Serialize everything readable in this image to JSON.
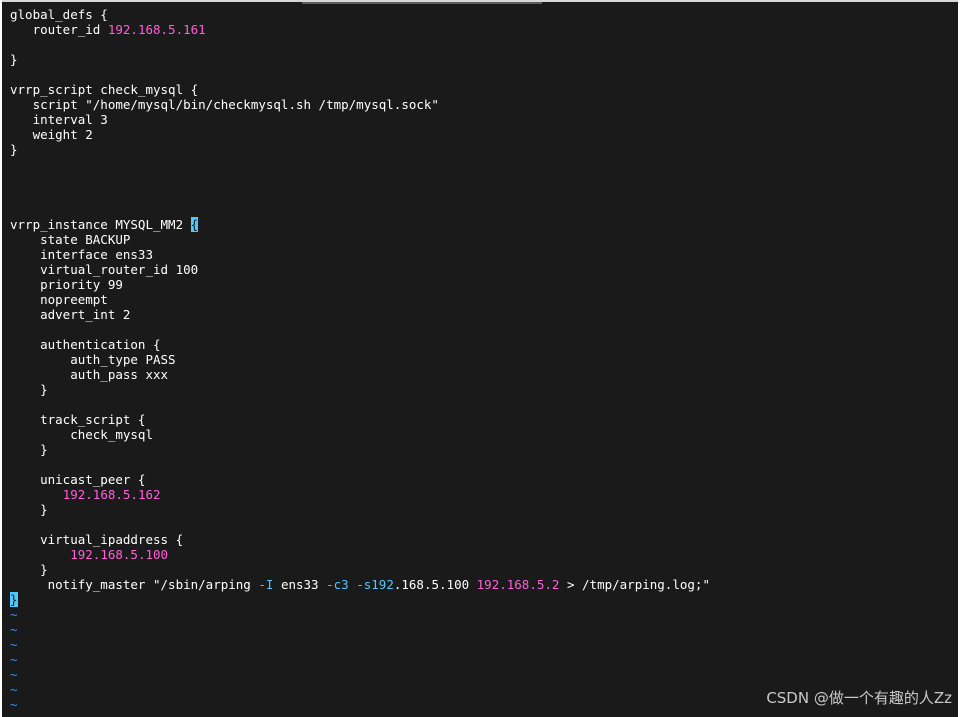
{
  "editor": {
    "lines": [
      [
        {
          "t": "global_defs {"
        }
      ],
      [
        {
          "t": "   router_id "
        },
        {
          "t": "192.168.5.161",
          "c": "magenta"
        }
      ],
      [
        {
          "t": ""
        }
      ],
      [
        {
          "t": "}"
        }
      ],
      [
        {
          "t": ""
        }
      ],
      [
        {
          "t": "vrrp_script check_mysql {"
        }
      ],
      [
        {
          "t": "   script \"/home/mysql/bin/checkmysql.sh /tmp/mysql.sock\""
        }
      ],
      [
        {
          "t": "   interval 3"
        }
      ],
      [
        {
          "t": "   weight 2"
        }
      ],
      [
        {
          "t": "}"
        }
      ],
      [
        {
          "t": ""
        }
      ],
      [
        {
          "t": ""
        }
      ],
      [
        {
          "t": ""
        }
      ],
      [
        {
          "t": ""
        }
      ],
      [
        {
          "t": "vrrp_instance MYSQL_MM2 "
        },
        {
          "t": "{",
          "c": "cursor"
        }
      ],
      [
        {
          "t": "    state BACKUP"
        }
      ],
      [
        {
          "t": "    interface ens33"
        }
      ],
      [
        {
          "t": "    virtual_router_id 100"
        }
      ],
      [
        {
          "t": "    priority 99"
        }
      ],
      [
        {
          "t": "    nopreempt"
        }
      ],
      [
        {
          "t": "    advert_int 2"
        }
      ],
      [
        {
          "t": ""
        }
      ],
      [
        {
          "t": "    authentication {"
        }
      ],
      [
        {
          "t": "        auth_type PASS"
        }
      ],
      [
        {
          "t": "        auth_pass xxx"
        }
      ],
      [
        {
          "t": "    }"
        }
      ],
      [
        {
          "t": ""
        }
      ],
      [
        {
          "t": "    track_script {"
        }
      ],
      [
        {
          "t": "        check_mysql"
        }
      ],
      [
        {
          "t": "    }"
        }
      ],
      [
        {
          "t": ""
        }
      ],
      [
        {
          "t": "    unicast_peer {"
        }
      ],
      [
        {
          "t": "       "
        },
        {
          "t": "192.168.5.162",
          "c": "magenta"
        }
      ],
      [
        {
          "t": "    }"
        }
      ],
      [
        {
          "t": ""
        }
      ],
      [
        {
          "t": "    virtual_ipaddress {"
        }
      ],
      [
        {
          "t": "        "
        },
        {
          "t": "192.168.5.100",
          "c": "magenta"
        }
      ],
      [
        {
          "t": "    }"
        }
      ],
      [
        {
          "t": "     notify_master \"/sbin/arping "
        },
        {
          "t": "-I",
          "c": "cyan"
        },
        {
          "t": " ens33 "
        },
        {
          "t": "-c3",
          "c": "cyan"
        },
        {
          "t": " "
        },
        {
          "t": "-s192",
          "c": "cyan"
        },
        {
          "t": ".168.5.100 "
        },
        {
          "t": "192.168.5.2",
          "c": "magenta"
        },
        {
          "t": " > /tmp/arping.log;\""
        }
      ],
      [
        {
          "t": "}",
          "c": "cursor"
        }
      ],
      [
        {
          "t": "~",
          "c": "tilde"
        }
      ],
      [
        {
          "t": "~",
          "c": "tilde"
        }
      ],
      [
        {
          "t": "~",
          "c": "tilde"
        }
      ],
      [
        {
          "t": "~",
          "c": "tilde"
        }
      ],
      [
        {
          "t": "~",
          "c": "tilde"
        }
      ],
      [
        {
          "t": "~",
          "c": "tilde"
        }
      ],
      [
        {
          "t": "~",
          "c": "tilde"
        }
      ]
    ]
  },
  "watermark": "CSDN @做一个有趣的人Zz",
  "colors": {
    "background": "#1a1a1a",
    "text": "#ffffff",
    "number_highlight": "#ff5fd7",
    "option_highlight": "#4fc7ff",
    "tilde": "#3a8fff"
  }
}
